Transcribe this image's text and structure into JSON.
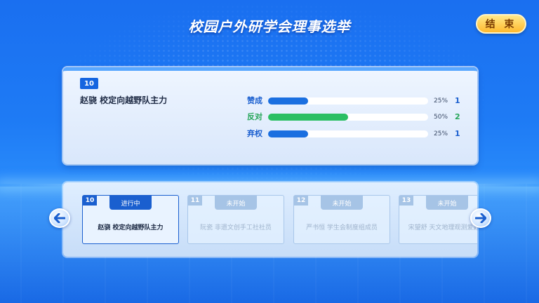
{
  "header": {
    "title": "校园户外研学会理事选举",
    "end_button_label": "结 束"
  },
  "current": {
    "number": "10",
    "candidate": "赵骁 校定向越野队主力",
    "votes": [
      {
        "label": "赞成",
        "fraction": 0.25,
        "percent": "25%",
        "count": "1",
        "color": "#1a6fe0",
        "label_color": "#1a5fcf"
      },
      {
        "label": "反对",
        "fraction": 0.5,
        "percent": "50%",
        "count": "2",
        "color": "#2bbf63",
        "label_color": "#27a65a"
      },
      {
        "label": "弃权",
        "fraction": 0.25,
        "percent": "25%",
        "count": "1",
        "color": "#1a6fe0",
        "label_color": "#1a5fcf"
      }
    ]
  },
  "candidates": [
    {
      "number": "10",
      "status": "进行中",
      "text": "赵骁 校定向越野队主力",
      "active": true
    },
    {
      "number": "11",
      "status": "未开始",
      "text": "阮瓷 非遗文创手工社社员",
      "active": false
    },
    {
      "number": "12",
      "status": "未开始",
      "text": "严书恒 学生会制度组成员",
      "active": false
    },
    {
      "number": "13",
      "status": "未开始",
      "text": "宋望舒 天文地理观测爱好者",
      "active": false
    }
  ],
  "nav": {
    "prev_icon": "arrow-left-icon",
    "next_icon": "arrow-right-icon"
  }
}
